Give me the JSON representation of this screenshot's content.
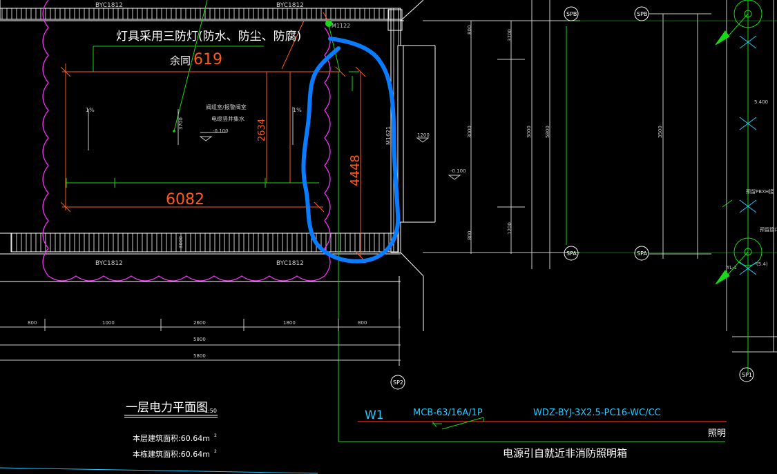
{
  "colors": {
    "background": "#000000",
    "wall": "#ffffff",
    "dim_red": "#ff5a1e",
    "green": "#18d918",
    "magenta": "#ff33ff",
    "cyan": "#22c9ff",
    "blue_mark": "#0a7cff",
    "red_line": "#ff2020"
  },
  "labels": {
    "top_beam_left": "BYC1812",
    "top_beam_right": "BYC1812",
    "bottom_beam_left": "BYC1812",
    "bottom_beam_right": "BYC1812",
    "lamp_note": "灯具采用三防灯(防水、防尘、防腐)",
    "remaining_prefix": "余同",
    "dim_619": "619",
    "dim_6082": "6082",
    "dim_2634": "2634",
    "dim_4448": "4448",
    "door_m1122": "M1122",
    "door_m1621": "M1621",
    "room_name_line1": "阀组室/报警阀室",
    "room_name_line2": "电缆竖井集水",
    "room_level": "-0.100",
    "left_note": "1%",
    "inner_note": "1%",
    "vertical_dim_left": "3700",
    "vertical_dim_mid": "3000",
    "axis_spb_right": "SPB",
    "axis_spb_far": "SPB",
    "axis_spa_right": "SPA",
    "axis_spa_far": "SPA",
    "axis_sp2": "SP2",
    "axis_sp1": "SP1",
    "bottom_dim_1": "800",
    "bottom_dim_2": "1000",
    "bottom_dim_3": "2600",
    "bottom_dim_4": "1800",
    "bottom_dim_5": "800",
    "bottom_total_1": "5800",
    "bottom_total_2": "5800",
    "level_right": "-0.100",
    "right_dims": [
      "800",
      "3700",
      "3000",
      "3000",
      "800",
      "5800",
      "1200",
      "3500"
    ],
    "small_right_1": "5.400",
    "small_right_2": "预留PBXH接",
    "small_right_3": "预留接口",
    "small_right_4": "YL-1",
    "small_right_5": "(5.4)"
  },
  "title_block": {
    "title": "一层电力平面图",
    "scale": "1:50",
    "area_1": "本层建筑面积:60.64m",
    "area_2": "本栋建筑面积:60.64m",
    "sup": "2"
  },
  "circuit": {
    "circuit_id": "W1",
    "breaker": "MCB-63/16A/1P",
    "cable": "WDZ-BYJ-3X2.5-PC16-WC/CC",
    "load": "照明",
    "source_note": "电源引自就近非消防照明箱"
  }
}
